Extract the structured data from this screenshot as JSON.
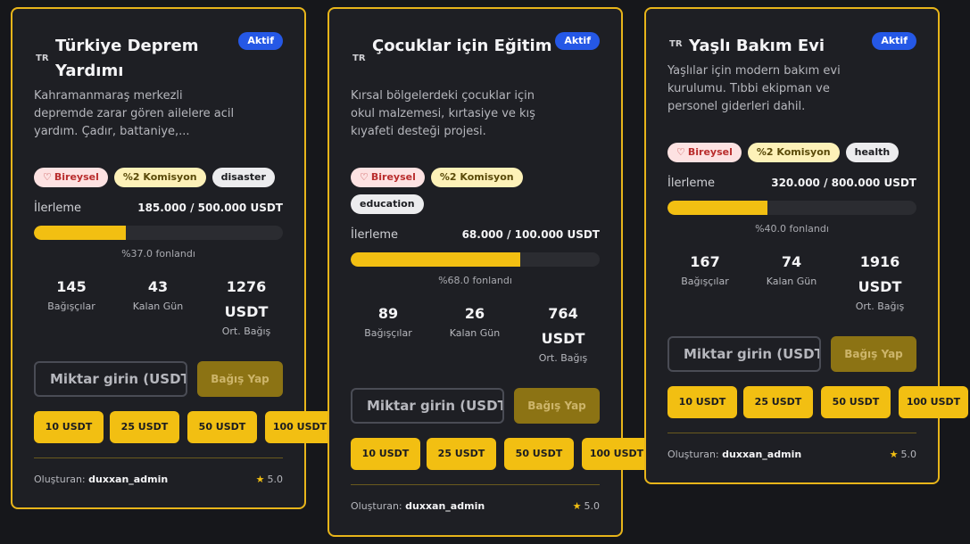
{
  "cards": [
    {
      "country_code": "TR",
      "title": "Türkiye Deprem Yardımı",
      "status": "Aktif",
      "description": "Kahramanmaraş merkezli depremde zarar gören ailelere acil yardım. Çadır, battaniye,...",
      "tags": {
        "type": "Bireysel",
        "fee": "%2 Komisyon",
        "category": "disaster"
      },
      "progress_label": "İlerleme",
      "progress_amount": "185.000 / 500.000 USDT",
      "progress_fraction": 0.37,
      "funded_text": "%37.0 fonlandı",
      "stats": [
        {
          "value": "145",
          "label": "Bağışçılar"
        },
        {
          "value": "43",
          "label": "Kalan Gün"
        },
        {
          "value": "1276 USDT",
          "label": "Ort. Bağış"
        }
      ],
      "amount_placeholder": "Miktar girin (USDT)",
      "donate_label": "Bağış Yap",
      "quick_amounts": [
        "10 USDT",
        "25 USDT",
        "50 USDT",
        "100 USDT"
      ],
      "creator_label": "Oluşturan:",
      "creator_name": "duxxan_admin",
      "rating": "5.0"
    },
    {
      "country_code": "TR",
      "title": "Çocuklar için Eğitim",
      "status": "Aktif",
      "description": "Kırsal bölgelerdeki çocuklar için okul malzemesi, kırtasiye ve kış kıyafeti desteği projesi.",
      "tags": {
        "type": "Bireysel",
        "fee": "%2 Komisyon",
        "category": "education"
      },
      "progress_label": "İlerleme",
      "progress_amount": "68.000 / 100.000 USDT",
      "progress_fraction": 0.68,
      "funded_text": "%68.0 fonlandı",
      "stats": [
        {
          "value": "89",
          "label": "Bağışçılar"
        },
        {
          "value": "26",
          "label": "Kalan Gün"
        },
        {
          "value": "764 USDT",
          "label": "Ort. Bağış"
        }
      ],
      "amount_placeholder": "Miktar girin (USDT)",
      "donate_label": "Bağış Yap",
      "quick_amounts": [
        "10 USDT",
        "25 USDT",
        "50 USDT",
        "100 USDT"
      ],
      "creator_label": "Oluşturan:",
      "creator_name": "duxxan_admin",
      "rating": "5.0"
    },
    {
      "country_code": "TR",
      "title": "Yaşlı Bakım Evi",
      "status": "Aktif",
      "description": "Yaşlılar için modern bakım evi kurulumu. Tıbbi ekipman ve personel giderleri dahil.",
      "tags": {
        "type": "Bireysel",
        "fee": "%2 Komisyon",
        "category": "health"
      },
      "progress_label": "İlerleme",
      "progress_amount": "320.000 / 800.000 USDT",
      "progress_fraction": 0.4,
      "funded_text": "%40.0 fonlandı",
      "stats": [
        {
          "value": "167",
          "label": "Bağışçılar"
        },
        {
          "value": "74",
          "label": "Kalan Gün"
        },
        {
          "value": "1916 USDT",
          "label": "Ort. Bağış"
        }
      ],
      "amount_placeholder": "Miktar girin (USDT)",
      "donate_label": "Bağış Yap",
      "quick_amounts": [
        "10 USDT",
        "25 USDT",
        "50 USDT",
        "100 USDT"
      ],
      "creator_label": "Oluşturan:",
      "creator_name": "duxxan_admin",
      "rating": "5.0"
    }
  ],
  "colors": {
    "accent": "#f2bf12",
    "card_border": "#e8b51a",
    "status_badge": "#2558e6",
    "background": "#16171b"
  },
  "icons": {
    "heart": "heart-icon",
    "star": "star-icon"
  }
}
